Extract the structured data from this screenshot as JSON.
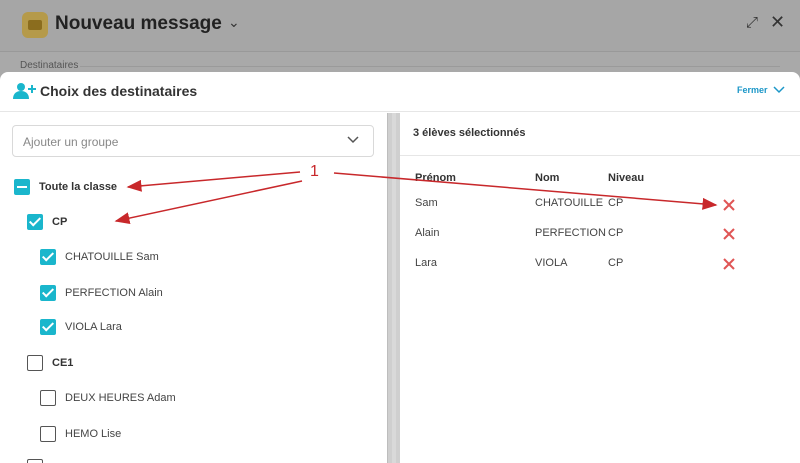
{
  "background_window": {
    "title": "Nouveau message",
    "destinataires_label": "Destinataires"
  },
  "modal": {
    "title": "Choix des destinataires",
    "close_label": "Fermer"
  },
  "left": {
    "group_select_placeholder": "Ajouter un groupe",
    "tree": [
      {
        "label": "Toute la classe",
        "state": "indeterminate",
        "level": 0
      },
      {
        "label": "CP",
        "state": "checked",
        "level": 1
      },
      {
        "label": "CHATOUILLE Sam",
        "state": "checked",
        "level": 2
      },
      {
        "label": "PERFECTION Alain",
        "state": "checked",
        "level": 2
      },
      {
        "label": "VIOLA Lara",
        "state": "checked",
        "level": 2
      },
      {
        "label": "CE1",
        "state": "unchecked",
        "level": 1
      },
      {
        "label": "DEUX HEURES Adam",
        "state": "unchecked",
        "level": 2
      },
      {
        "label": "HEMO Lise",
        "state": "unchecked",
        "level": 2
      }
    ]
  },
  "right": {
    "selected_count": "3 élèves sélectionnés",
    "columns": [
      "Prénom",
      "Nom",
      "Niveau"
    ],
    "rows": [
      {
        "prenom": "Sam",
        "nom": "CHATOUILLE",
        "niveau": "CP"
      },
      {
        "prenom": "Alain",
        "nom": "PERFECTION",
        "niveau": "CP"
      },
      {
        "prenom": "Lara",
        "nom": "VIOLA",
        "niveau": "CP"
      }
    ]
  },
  "annotation": {
    "label": "1"
  },
  "colors": {
    "accent": "#1ab6cc",
    "link": "#1c97c8",
    "remove": "#e05555",
    "annotation": "#c8282b"
  }
}
